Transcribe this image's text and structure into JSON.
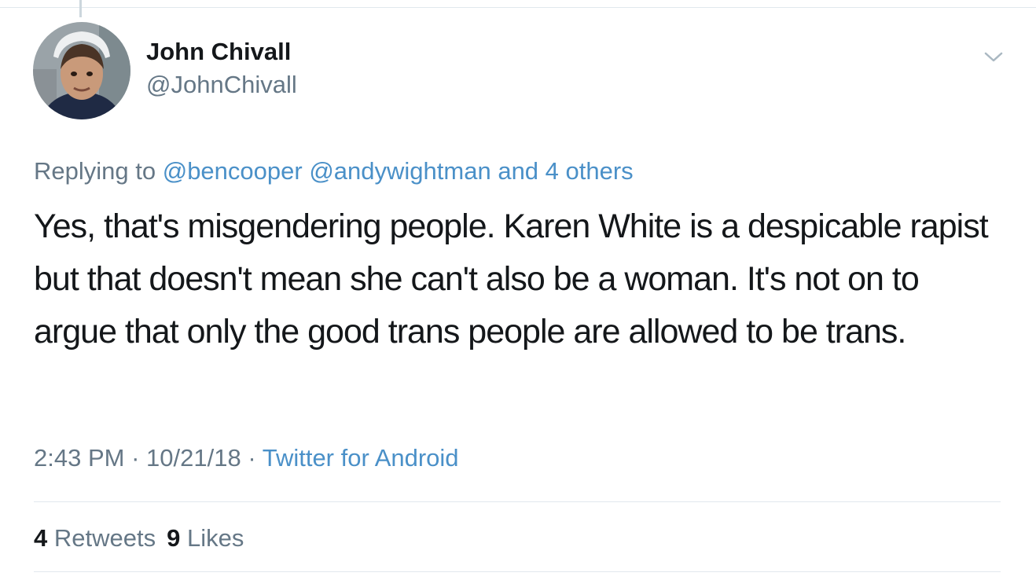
{
  "user": {
    "display_name": "John Chivall",
    "handle": "@JohnChivall",
    "avatar_icon": "profile-photo"
  },
  "menu": {
    "icon": "chevron-down-icon"
  },
  "reply": {
    "prefix": "Replying to",
    "mention1": "@bencooper",
    "mention2": "@andywightman",
    "others": "and 4 others"
  },
  "tweet": {
    "text": "Yes, that's misgendering people. Karen White is a despicable rapist but that doesn't mean she can't also be a woman. It's not on to argue that only the good trans people are allowed to be trans."
  },
  "meta": {
    "time": "2:43 PM",
    "sep1": "·",
    "date": "10/21/18",
    "sep2": "·",
    "source": "Twitter for Android"
  },
  "stats": {
    "retweets_count": "4",
    "retweets_label": "Retweets",
    "likes_count": "9",
    "likes_label": "Likes"
  },
  "colors": {
    "link": "#4a90c8",
    "secondary_text": "#657786",
    "primary_text": "#14171a",
    "divider": "#e1e8ed"
  }
}
